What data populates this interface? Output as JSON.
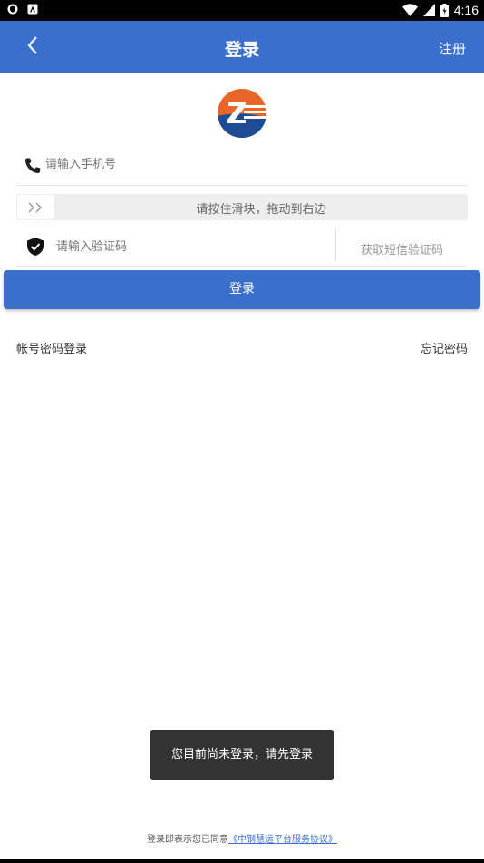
{
  "status_bar": {
    "time": "4:16"
  },
  "header": {
    "title": "登录",
    "register_label": "注册"
  },
  "form": {
    "phone_placeholder": "请输入手机号",
    "slider_text": "请按住滑块，拖动到右边",
    "code_placeholder": "请输入验证码",
    "get_code_label": "获取短信验证码",
    "login_button": "登录"
  },
  "links": {
    "account_login": "帐号密码登录",
    "forgot_password": "忘记密码"
  },
  "toast": {
    "message": "您目前尚未登录，请先登录"
  },
  "agreement": {
    "prefix": "登录即表示您已同意",
    "link_text": "《中钢慧运平台服务协议》"
  },
  "colors": {
    "primary": "#3a6fcc",
    "logo_orange": "#e8662a",
    "logo_blue": "#1f4c96",
    "toast_bg": "#333333"
  }
}
